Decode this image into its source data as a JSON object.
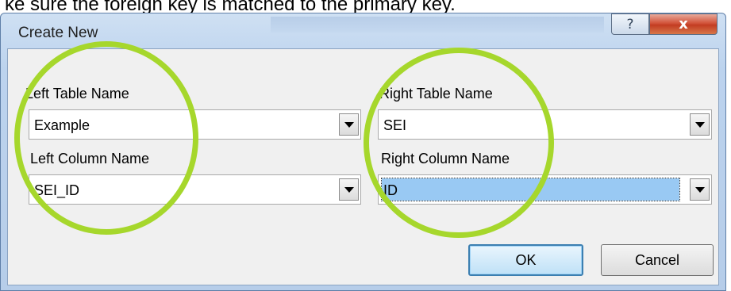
{
  "caption": "ke sure the foreign key is matched to the primary key.",
  "window": {
    "title": "Create New",
    "help_glyph": "?",
    "close_glyph": "x"
  },
  "left": {
    "table_label": "Left Table Name",
    "table_value": "Example",
    "column_label": "Left Column Name",
    "column_value": "SEI_ID"
  },
  "right": {
    "table_label": "Right Table Name",
    "table_value": "SEI",
    "column_label": "Right Column Name",
    "column_value": "ID"
  },
  "buttons": {
    "ok_label": "OK",
    "cancel_label": "Cancel"
  },
  "colors": {
    "annotation": "#a6d72c",
    "selection": "#99c9f3",
    "close_button": "#c23d22"
  },
  "icons": {
    "help": "help-icon",
    "close": "close-icon",
    "dropdown": "chevron-down-icon"
  }
}
